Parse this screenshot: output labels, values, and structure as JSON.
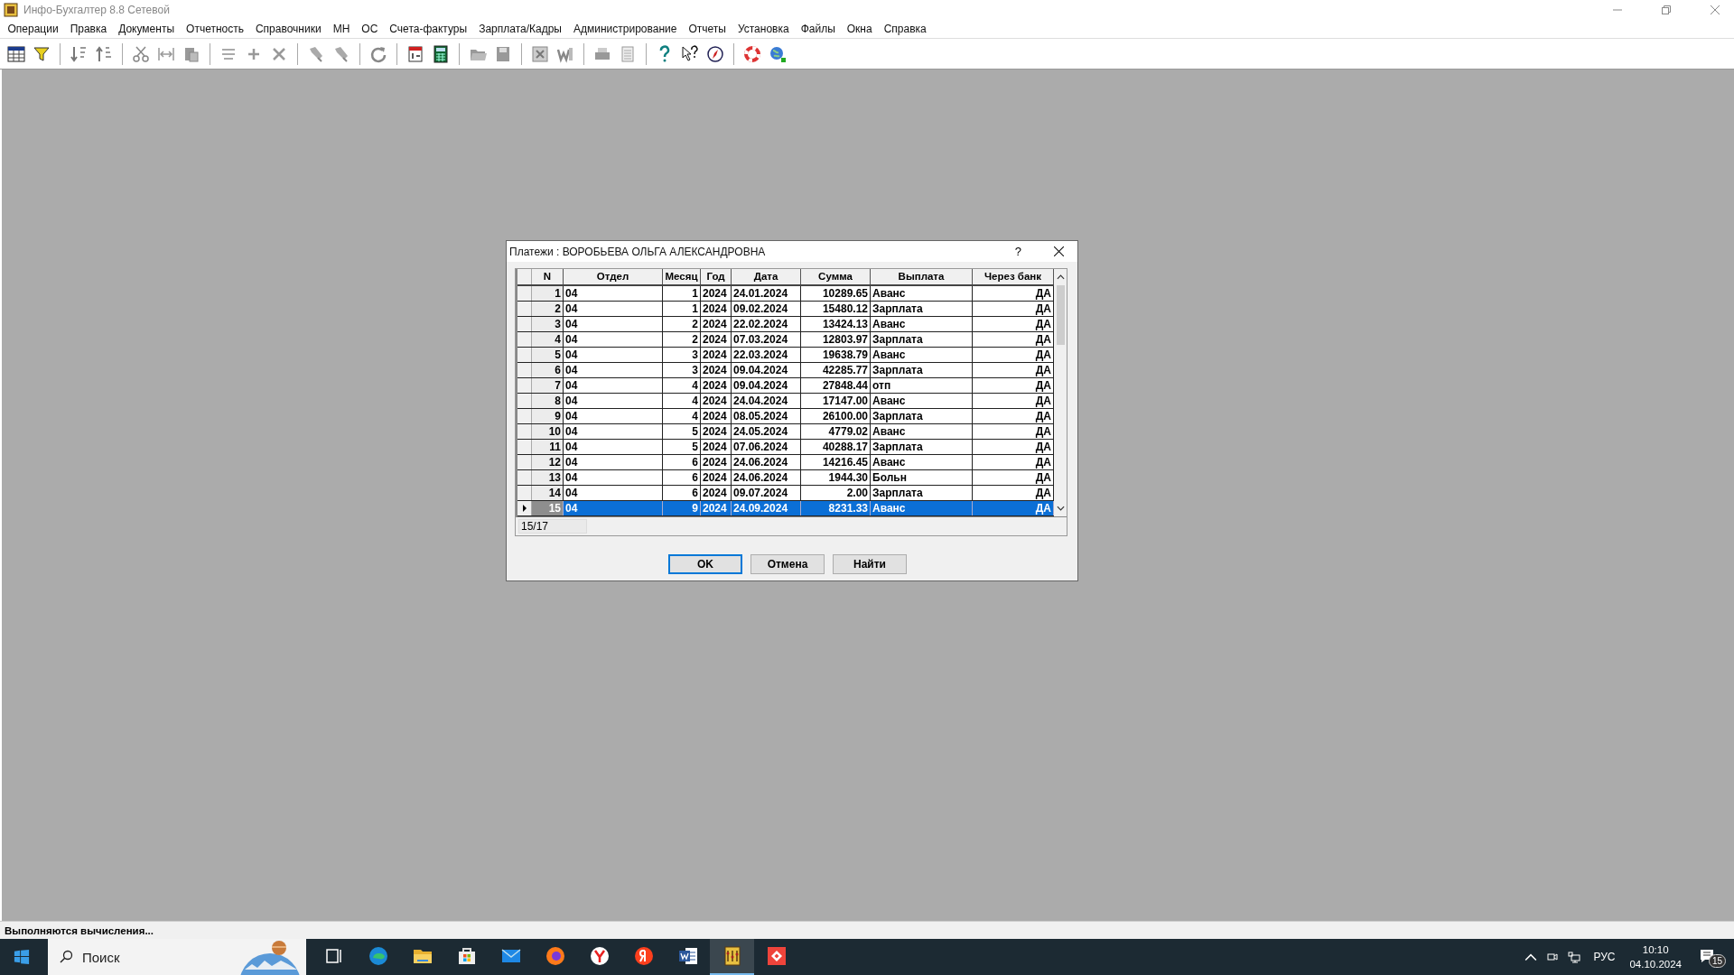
{
  "window": {
    "title": "Инфо-Бухгалтер 8.8 Сетевой"
  },
  "menu": [
    "Операции",
    "Правка",
    "Документы",
    "Отчетность",
    "Справочники",
    "МН",
    "ОС",
    "Счета-фактуры",
    "Зарплата/Кадры",
    "Администрирование",
    "Отчеты",
    "Установка",
    "Файлы",
    "Окна",
    "Справка"
  ],
  "dialog": {
    "title": "Платежи :  ВОРОБЬЕВА ОЛЬГА АЛЕКСАНДРОВНА",
    "help": "?",
    "columns": [
      "N",
      "Отдел",
      "Месяц",
      "Год",
      "Дата",
      "Сумма",
      "Выплата",
      "Через банк"
    ],
    "rows": [
      {
        "cells": [
          "1",
          "04",
          "1",
          "2024",
          "24.01.2024",
          "10289.65",
          "Аванс",
          "ДА"
        ],
        "selected": false
      },
      {
        "cells": [
          "2",
          "04",
          "1",
          "2024",
          "09.02.2024",
          "15480.12",
          "Зарплата",
          "ДА"
        ],
        "selected": false
      },
      {
        "cells": [
          "3",
          "04",
          "2",
          "2024",
          "22.02.2024",
          "13424.13",
          "Аванс",
          "ДА"
        ],
        "selected": false
      },
      {
        "cells": [
          "4",
          "04",
          "2",
          "2024",
          "07.03.2024",
          "12803.97",
          "Зарплата",
          "ДА"
        ],
        "selected": false
      },
      {
        "cells": [
          "5",
          "04",
          "3",
          "2024",
          "22.03.2024",
          "19638.79",
          "Аванс",
          "ДА"
        ],
        "selected": false
      },
      {
        "cells": [
          "6",
          "04",
          "3",
          "2024",
          "09.04.2024",
          "42285.77",
          "Зарплата",
          "ДА"
        ],
        "selected": false
      },
      {
        "cells": [
          "7",
          "04",
          "4",
          "2024",
          "09.04.2024",
          "27848.44",
          "отп",
          "ДА"
        ],
        "selected": false
      },
      {
        "cells": [
          "8",
          "04",
          "4",
          "2024",
          "24.04.2024",
          "17147.00",
          "Аванс",
          "ДА"
        ],
        "selected": false
      },
      {
        "cells": [
          "9",
          "04",
          "4",
          "2024",
          "08.05.2024",
          "26100.00",
          "Зарплата",
          "ДА"
        ],
        "selected": false
      },
      {
        "cells": [
          "10",
          "04",
          "5",
          "2024",
          "24.05.2024",
          "4779.02",
          "Аванс",
          "ДА"
        ],
        "selected": false
      },
      {
        "cells": [
          "11",
          "04",
          "5",
          "2024",
          "07.06.2024",
          "40288.17",
          "Зарплата",
          "ДА"
        ],
        "selected": false
      },
      {
        "cells": [
          "12",
          "04",
          "6",
          "2024",
          "24.06.2024",
          "14216.45",
          "Аванс",
          "ДА"
        ],
        "selected": false
      },
      {
        "cells": [
          "13",
          "04",
          "6",
          "2024",
          "24.06.2024",
          "1944.30",
          "Больн",
          "ДА"
        ],
        "selected": false
      },
      {
        "cells": [
          "14",
          "04",
          "6",
          "2024",
          "09.07.2024",
          "2.00",
          "Зарплата",
          "ДА"
        ],
        "selected": false
      },
      {
        "cells": [
          "15",
          "04",
          "9",
          "2024",
          "24.09.2024",
          "8231.33",
          "Аванс",
          "ДА"
        ],
        "selected": true
      }
    ],
    "record_counter": "15/17",
    "buttons": [
      {
        "label": "OK",
        "default": true
      },
      {
        "label": "Отмена",
        "default": false
      },
      {
        "label": "Найти",
        "default": false
      }
    ]
  },
  "status_bar": "Выполняются вычисления...",
  "taskbar": {
    "search": {
      "placeholder": "Поиск"
    },
    "apps": [
      {
        "kind": "taskview",
        "active": false
      },
      {
        "kind": "edge",
        "active": false
      },
      {
        "kind": "explorer",
        "active": false
      },
      {
        "kind": "store",
        "active": false
      },
      {
        "kind": "mail",
        "active": false
      },
      {
        "kind": "firefox",
        "active": false
      },
      {
        "kind": "ybrowser",
        "active": false
      },
      {
        "kind": "yandex",
        "active": false
      },
      {
        "kind": "word",
        "active": false
      },
      {
        "kind": "accounting",
        "active": true
      },
      {
        "kind": "remote",
        "active": false
      }
    ],
    "language": "РУС",
    "time": "10:10",
    "date": "04.10.2024",
    "notifications": "15"
  }
}
